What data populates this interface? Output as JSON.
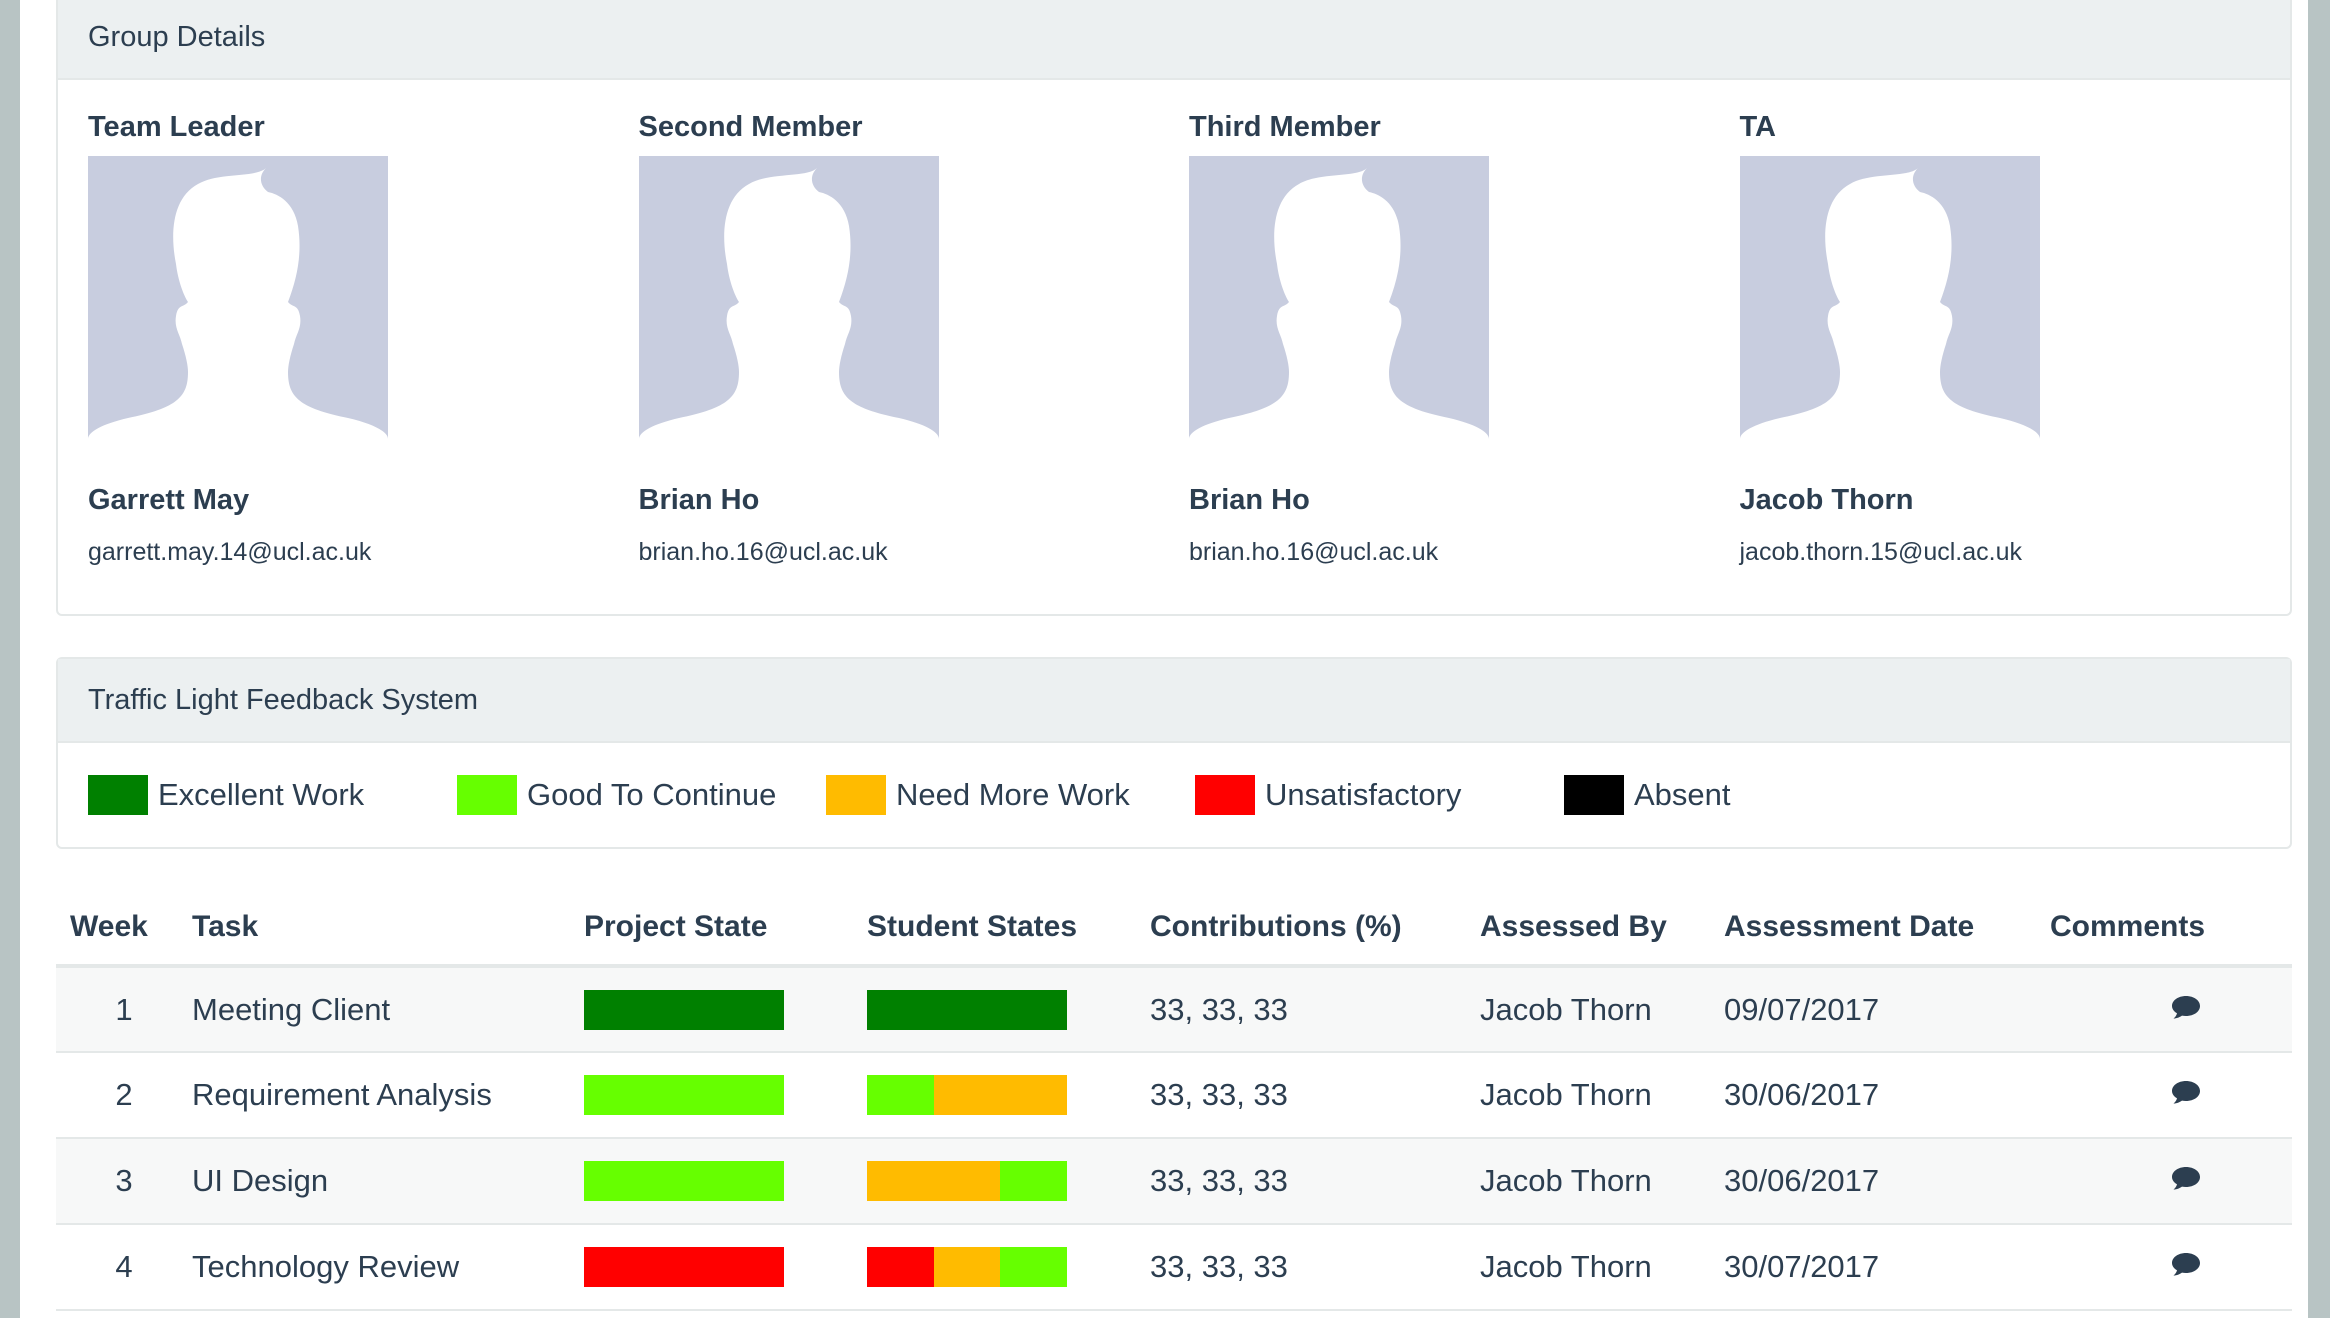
{
  "group": {
    "title": "Group Details",
    "members": [
      {
        "role": "Team Leader",
        "name": "Garrett May",
        "email": "garrett.may.14@ucl.ac.uk"
      },
      {
        "role": "Second Member",
        "name": "Brian Ho",
        "email": "brian.ho.16@ucl.ac.uk"
      },
      {
        "role": "Third Member",
        "name": "Brian Ho",
        "email": "brian.ho.16@ucl.ac.uk"
      },
      {
        "role": "TA",
        "name": "Jacob Thorn",
        "email": "jacob.thorn.15@ucl.ac.uk"
      }
    ]
  },
  "traffic": {
    "title": "Traffic Light Feedback System",
    "legend": [
      {
        "label": "Excellent Work",
        "color": "#008000"
      },
      {
        "label": "Good To Continue",
        "color": "#66ff00"
      },
      {
        "label": "Need More Work",
        "color": "#ffbb00"
      },
      {
        "label": "Unsatisfactory",
        "color": "#ff0000"
      },
      {
        "label": "Absent",
        "color": "#000000"
      }
    ]
  },
  "table": {
    "headers": {
      "week": "Week",
      "task": "Task",
      "project_state": "Project State",
      "student_states": "Student States",
      "contributions": "Contributions (%)",
      "assessed_by": "Assessed By",
      "assessment_date": "Assessment Date",
      "comments": "Comments"
    },
    "rows": [
      {
        "week": "1",
        "task": "Meeting Client",
        "project_state": "#008000",
        "student_states": [
          "#008000",
          "#008000",
          "#008000"
        ],
        "contributions": "33, 33, 33",
        "assessed_by": "Jacob Thorn",
        "date": "09/07/2017",
        "comment_icon": "comment-icon"
      },
      {
        "week": "2",
        "task": "Requirement Analysis",
        "project_state": "#66ff00",
        "student_states": [
          "#66ff00",
          "#ffbb00",
          "#ffbb00"
        ],
        "contributions": "33, 33, 33",
        "assessed_by": "Jacob Thorn",
        "date": "30/06/2017",
        "comment_icon": "comment-icon"
      },
      {
        "week": "3",
        "task": "UI Design",
        "project_state": "#66ff00",
        "student_states": [
          "#ffbb00",
          "#ffbb00",
          "#66ff00"
        ],
        "contributions": "33, 33, 33",
        "assessed_by": "Jacob Thorn",
        "date": "30/06/2017",
        "comment_icon": "comment-icon"
      },
      {
        "week": "4",
        "task": "Technology Review",
        "project_state": "#ff0000",
        "student_states": [
          "#ff0000",
          "#ffbb00",
          "#66ff00"
        ],
        "contributions": "33, 33, 33",
        "assessed_by": "Jacob Thorn",
        "date": "30/07/2017",
        "comment_icon": "comment-icon"
      }
    ]
  }
}
